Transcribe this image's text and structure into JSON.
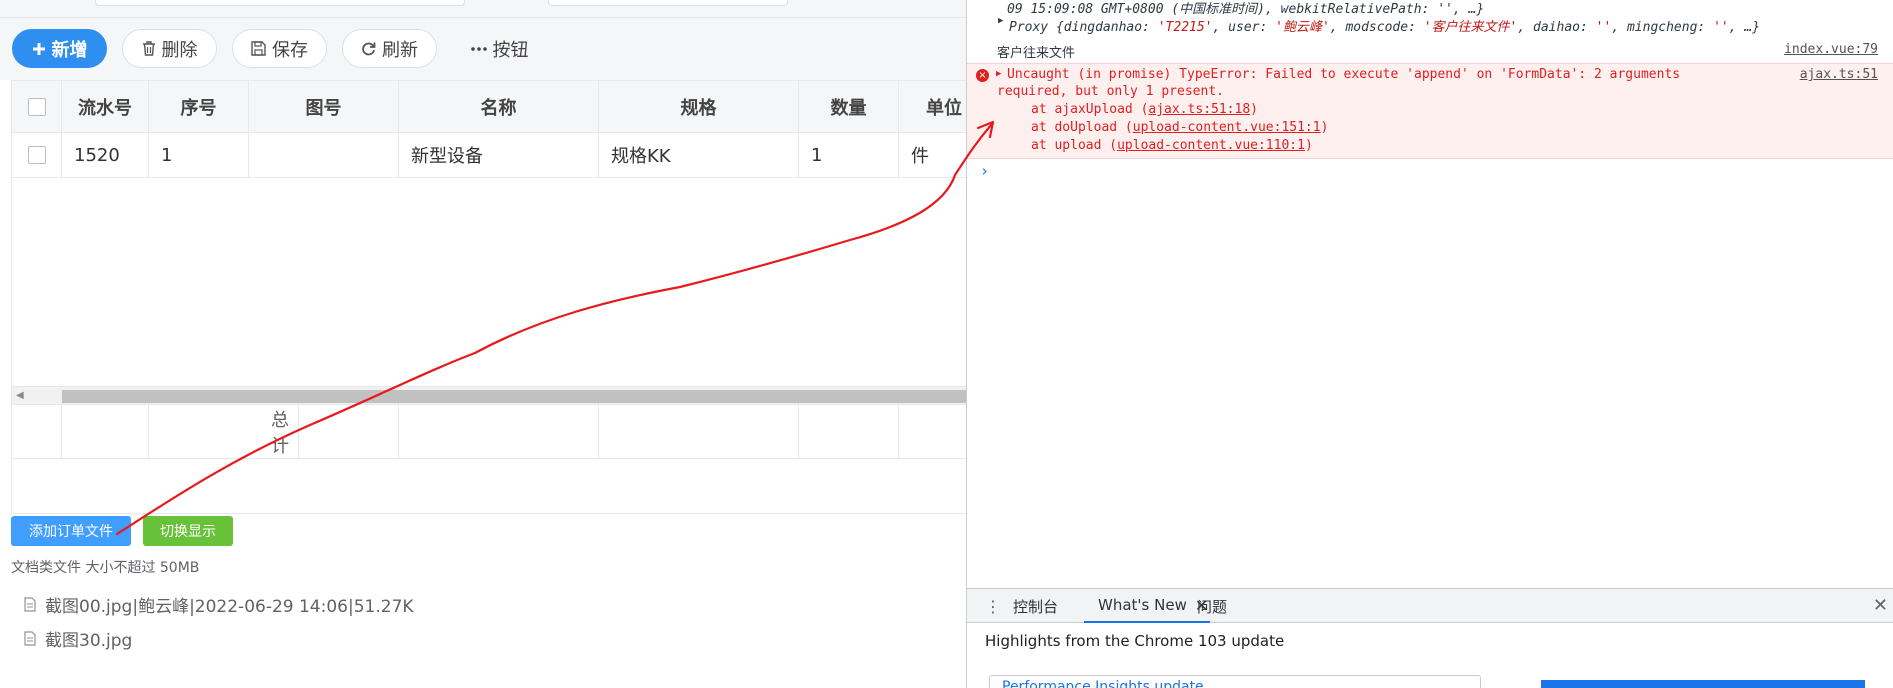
{
  "toolbar": {
    "add_label": "新增",
    "delete_label": "删除",
    "save_label": "保存",
    "refresh_label": "刷新",
    "more_label": "按钮"
  },
  "table": {
    "columns": [
      "流水号",
      "序号",
      "图号",
      "名称",
      "规格",
      "数量",
      "单位"
    ],
    "rows": [
      [
        "1520",
        "1",
        "",
        "新型设备",
        "规格KK",
        "1",
        "件"
      ]
    ],
    "footer_total_label": "总计"
  },
  "upload": {
    "add_file_label": "添加订单文件",
    "toggle_display_label": "切换显示",
    "hint": "文档类文件 大小不超过 50MB",
    "files": [
      "截图00.jpg|鲍云峰|2022-06-29 14:06|51.27K",
      "截图30.jpg"
    ]
  },
  "console": {
    "line0_text": "09 15:09:08 GMT+0800 (中国标准时间), webkitRelativePath: '', …}",
    "proxy_line": {
      "prefix": "Proxy {dingdanhao: ",
      "v1": "'T2215'",
      "k2": ", user: ",
      "v2": "'鲍云峰'",
      "k3": ", modscode: ",
      "v3": "'客户往来文件'",
      "k4": ", daihao: ",
      "v4": "''",
      "k5": ", mingcheng: ",
      "v5": "''",
      "suffix": ", …}"
    },
    "log_text": "客户往来文件",
    "log_source": "index.vue:79",
    "error": {
      "line1": "Uncaught (in promise) TypeError: Failed to execute 'append' on 'FormData': 2 arguments",
      "line2": "required, but only 1 present.",
      "source": "ajax.ts:51",
      "stack": [
        {
          "prefix": "at ajaxUpload (",
          "link": "ajax.ts:51:18",
          "suffix": ")"
        },
        {
          "prefix": "at doUpload (",
          "link": "upload-content.vue:151:1",
          "suffix": ")"
        },
        {
          "prefix": "at upload (",
          "link": "upload-content.vue:110:1",
          "suffix": ")"
        }
      ]
    },
    "prompt_symbol": "›"
  },
  "drawer": {
    "tabs": [
      "控制台",
      "What's New",
      "问题"
    ],
    "active_tab": "What's New",
    "whats_new_title": "Highlights from the Chrome 103 update",
    "link_text": "Performance Insights update"
  },
  "colors": {
    "primary": "#2e8ff0",
    "upload_blue": "#409eff",
    "toggle_green": "#67c23a",
    "error_red": "#e0201f",
    "error_bg": "#fff0f0",
    "annotation_red": "#e8191d"
  },
  "icons": {
    "add": "plus-icon",
    "delete": "trash-icon",
    "save": "floppy-disk-icon",
    "refresh": "refresh-icon",
    "more": "ellipsis-icon",
    "file": "document-icon",
    "error": "error-circle-icon"
  }
}
